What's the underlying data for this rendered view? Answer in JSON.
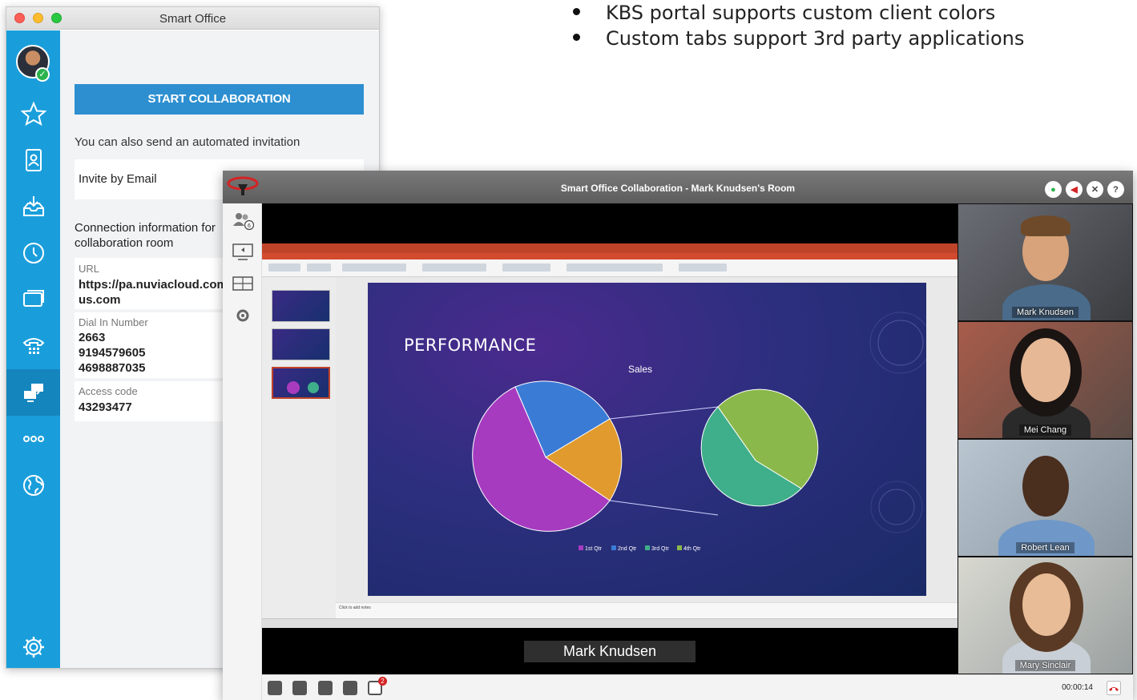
{
  "bullets": [
    "KBS portal supports custom client colors",
    "Custom tabs support 3rd party applications"
  ],
  "smart_office": {
    "window_title": "Smart Office",
    "start_button": "START COLLABORATION",
    "invite_text": "You can also send an automated invitation",
    "invite_email": "Invite by Email",
    "connection_title": "Connection information for collaboration room",
    "url_label": "URL",
    "url_value_1": "https://pa.nuviacloud.com/",
    "url_value_2": "us.com",
    "dialin_label": "Dial In Number",
    "dialin_1": "2663",
    "dialin_2": "9194579605",
    "dialin_3": "4698887035",
    "access_label": "Access code",
    "access_value": "43293477",
    "sidebar_icons": [
      "star-icon",
      "contacts-icon",
      "inbox-download-icon",
      "clock-icon",
      "chat-window-icon",
      "phone-keypad-icon",
      "collaboration-icon",
      "more-icon",
      "globe-icon",
      "settings-gear-icon"
    ],
    "colors": {
      "sidebar": "#1a9edb",
      "sidebar_active": "#1585be",
      "button": "#2d8fd0"
    }
  },
  "collaboration": {
    "window_title": "Smart Office Collaboration - Mark Knudsen's Room",
    "participants_count": "6",
    "slide_title": "PERFORMANCE",
    "chart_title": "Sales",
    "legend": [
      "1st Qtr",
      "2nd Qtr",
      "3rd Qtr",
      "4th Qtr"
    ],
    "notes_placeholder": "Click to add notes",
    "caption": "Mark Knudsen",
    "videos": [
      {
        "name": "Mark Knudsen"
      },
      {
        "name": "Mei Chang"
      },
      {
        "name": "Robert Lean"
      },
      {
        "name": "Mary Sinclair"
      }
    ],
    "timer": "00:00:14",
    "notification_badge": "2"
  }
}
